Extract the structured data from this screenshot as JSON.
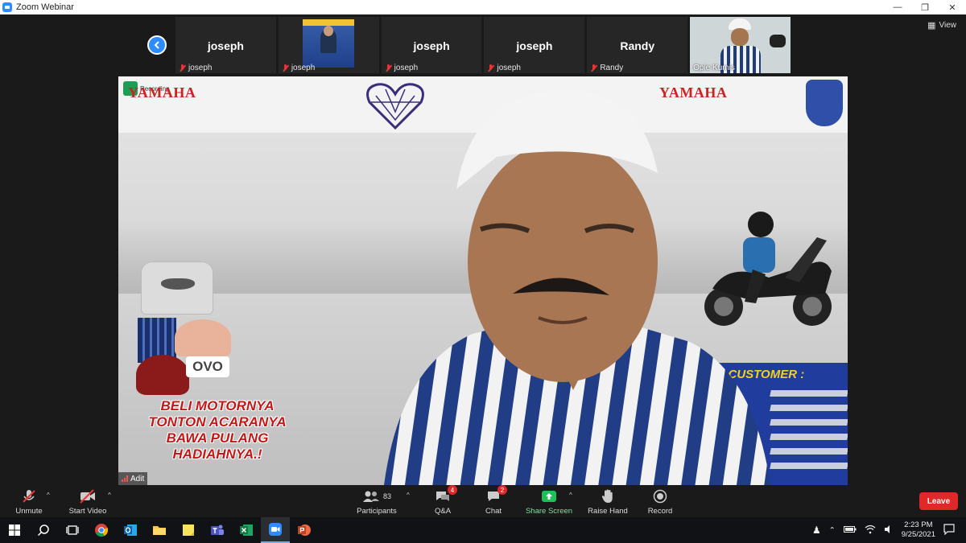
{
  "window": {
    "title": "Zoom Webinar"
  },
  "view_label": "View",
  "participants_strip": [
    {
      "big_name": "joseph",
      "footer_name": "joseph",
      "has_video": false
    },
    {
      "big_name": "",
      "footer_name": "joseph",
      "has_video": true
    },
    {
      "big_name": "joseph",
      "footer_name": "joseph",
      "has_video": false
    },
    {
      "big_name": "joseph",
      "footer_name": "joseph",
      "has_video": false
    },
    {
      "big_name": "Randy",
      "footer_name": "Randy",
      "has_video": false
    },
    {
      "big_name": "",
      "footer_name": "Opie Kumis",
      "has_video": true
    }
  ],
  "main_video": {
    "speaker_name": "Adit",
    "recording_label": "Recording",
    "brand_left": "YAMAHA",
    "brand_right": "YAMAHA",
    "ovo_label": "OVO",
    "promo_lines": [
      "BELI MOTORNYA",
      "TONTON ACARANYA",
      "BAWA PULANG",
      "HADIAHNYA.!"
    ],
    "customer_heading": "IT CUSTOMER :"
  },
  "toolbar": {
    "unmute": "Unmute",
    "start_video": "Start Video",
    "participants": "Participants",
    "participants_count": "83",
    "qa": "Q&A",
    "qa_badge": "4",
    "chat": "Chat",
    "chat_badge": "2",
    "share_screen": "Share Screen",
    "raise_hand": "Raise Hand",
    "record": "Record",
    "leave": "Leave"
  },
  "taskbar": {
    "time": "2:23 PM",
    "date": "9/25/2021",
    "apps": [
      "windows-start-icon",
      "search-icon",
      "task-view-icon",
      "chrome-icon",
      "outlook-icon",
      "file-explorer-icon",
      "sticky-notes-icon",
      "teams-icon",
      "excel-icon",
      "zoom-icon",
      "powerpoint-icon"
    ]
  },
  "colors": {
    "accent": "#2d8cff",
    "leave": "#e02828",
    "share": "#1fbf5a"
  }
}
